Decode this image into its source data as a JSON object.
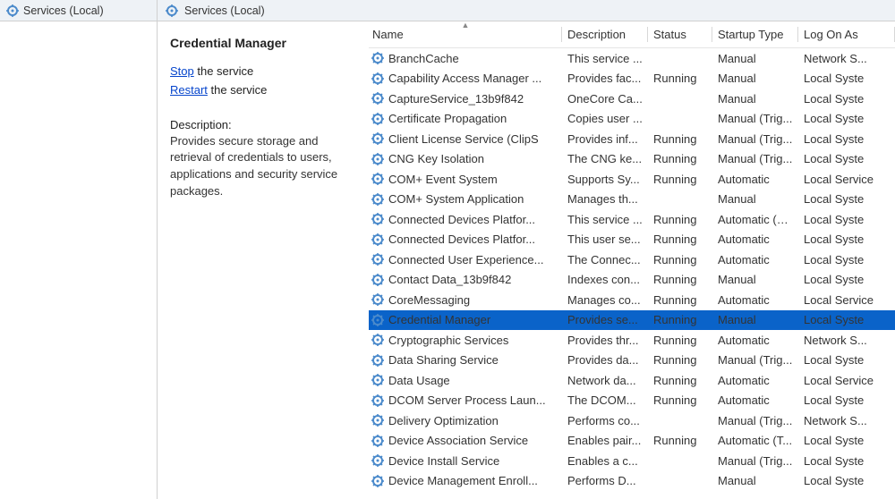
{
  "nav": {
    "tree_label": "Services (Local)"
  },
  "content": {
    "header_label": "Services (Local)"
  },
  "detail": {
    "selected_title": "Credential Manager",
    "stop_link": "Stop",
    "stop_suffix": " the service",
    "restart_link": "Restart",
    "restart_suffix": " the service",
    "description_label": "Description:",
    "description_text": "Provides secure storage and retrieval of credentials to users, applications and security service packages."
  },
  "columns": {
    "name": "Name",
    "description": "Description",
    "status": "Status",
    "startup": "Startup Type",
    "logon": "Log On As"
  },
  "services": [
    {
      "name": "BranchCache",
      "desc": "This service ...",
      "status": "",
      "startup": "Manual",
      "logon": "Network S..."
    },
    {
      "name": "Capability Access Manager ...",
      "desc": "Provides fac...",
      "status": "Running",
      "startup": "Manual",
      "logon": "Local Syste"
    },
    {
      "name": "CaptureService_13b9f842",
      "desc": "OneCore Ca...",
      "status": "",
      "startup": "Manual",
      "logon": "Local Syste"
    },
    {
      "name": "Certificate Propagation",
      "desc": "Copies user ...",
      "status": "",
      "startup": "Manual (Trig...",
      "logon": "Local Syste"
    },
    {
      "name": "Client License Service (ClipS",
      "desc": "Provides inf...",
      "status": "Running",
      "startup": "Manual (Trig...",
      "logon": "Local Syste"
    },
    {
      "name": "CNG Key Isolation",
      "desc": "The CNG ke...",
      "status": "Running",
      "startup": "Manual (Trig...",
      "logon": "Local Syste"
    },
    {
      "name": "COM+ Event System",
      "desc": "Supports Sy...",
      "status": "Running",
      "startup": "Automatic",
      "logon": "Local Service"
    },
    {
      "name": "COM+ System Application",
      "desc": "Manages th...",
      "status": "",
      "startup": "Manual",
      "logon": "Local Syste"
    },
    {
      "name": "Connected Devices Platfor...",
      "desc": "This service ...",
      "status": "Running",
      "startup": "Automatic (D...",
      "logon": "Local Syste"
    },
    {
      "name": "Connected Devices Platfor...",
      "desc": "This user se...",
      "status": "Running",
      "startup": "Automatic",
      "logon": "Local Syste"
    },
    {
      "name": "Connected User Experience...",
      "desc": "The Connec...",
      "status": "Running",
      "startup": "Automatic",
      "logon": "Local Syste"
    },
    {
      "name": "Contact Data_13b9f842",
      "desc": "Indexes con...",
      "status": "Running",
      "startup": "Manual",
      "logon": "Local Syste"
    },
    {
      "name": "CoreMessaging",
      "desc": "Manages co...",
      "status": "Running",
      "startup": "Automatic",
      "logon": "Local Service"
    },
    {
      "name": "Credential Manager",
      "desc": "Provides se...",
      "status": "Running",
      "startup": "Manual",
      "logon": "Local Syste",
      "selected": true
    },
    {
      "name": "Cryptographic Services",
      "desc": "Provides thr...",
      "status": "Running",
      "startup": "Automatic",
      "logon": "Network S..."
    },
    {
      "name": "Data Sharing Service",
      "desc": "Provides da...",
      "status": "Running",
      "startup": "Manual (Trig...",
      "logon": "Local Syste"
    },
    {
      "name": "Data Usage",
      "desc": "Network da...",
      "status": "Running",
      "startup": "Automatic",
      "logon": "Local Service"
    },
    {
      "name": "DCOM Server Process Laun...",
      "desc": "The DCOM...",
      "status": "Running",
      "startup": "Automatic",
      "logon": "Local Syste"
    },
    {
      "name": "Delivery Optimization",
      "desc": "Performs co...",
      "status": "",
      "startup": "Manual (Trig...",
      "logon": "Network S..."
    },
    {
      "name": "Device Association Service",
      "desc": "Enables pair...",
      "status": "Running",
      "startup": "Automatic (T...",
      "logon": "Local Syste"
    },
    {
      "name": "Device Install Service",
      "desc": "Enables a c...",
      "status": "",
      "startup": "Manual (Trig...",
      "logon": "Local Syste"
    },
    {
      "name": "Device Management Enroll...",
      "desc": "Performs D...",
      "status": "",
      "startup": "Manual",
      "logon": "Local Syste"
    }
  ]
}
